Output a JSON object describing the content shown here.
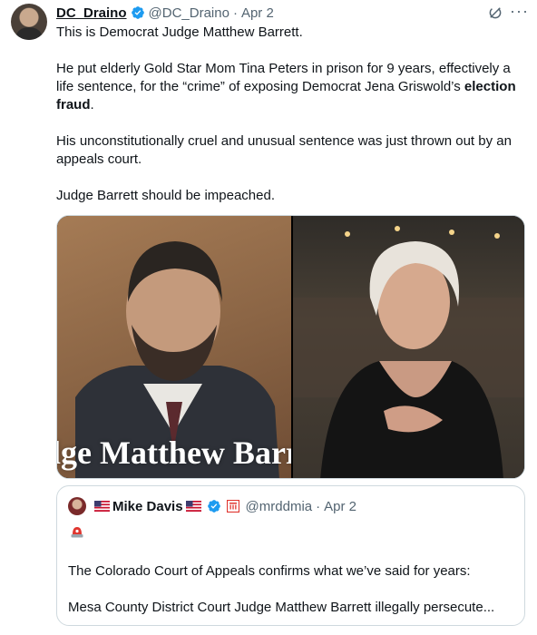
{
  "post": {
    "author_name": "DC_Draino",
    "handle": "@DC_Draino",
    "separator": "·",
    "date": "Apr 2",
    "more_label": "···",
    "paragraphs": {
      "p1": "This is Democrat Judge Matthew Barrett.",
      "p2_text": "He put elderly Gold Star Mom Tina Peters in prison for 9 years, effectively a life sentence, for the “crime” of exposing Democrat Jena Griswold’s ",
      "p2_bold": "election fraud",
      "p2_end": ".",
      "p3": "His unconstitutionally cruel and unusual sentence was just thrown out by an appeals court.",
      "p4": "Judge Barrett should be impeached."
    },
    "media": {
      "left_caption": "lge Matthew Barr"
    }
  },
  "quote": {
    "author_name": "Mike Davis",
    "handle": "@mrddmia",
    "separator": "·",
    "date": "Apr 2",
    "line1": "The Colorado Court of Appeals confirms what we’ve said for years:",
    "line2": "Mesa County District Court Judge Matthew Barrett illegally persecute..."
  },
  "icons": {
    "verified": "verified-badge-icon",
    "grok": "grok-icon",
    "more": "more-icon",
    "flag": "us-flag-icon",
    "gov": "government-affiliation-icon",
    "siren": "siren-emoji-icon"
  },
  "colors": {
    "verified_blue": "#1d9bf0",
    "text": "#0f1419",
    "muted": "#536471",
    "border": "#cfd9de"
  }
}
